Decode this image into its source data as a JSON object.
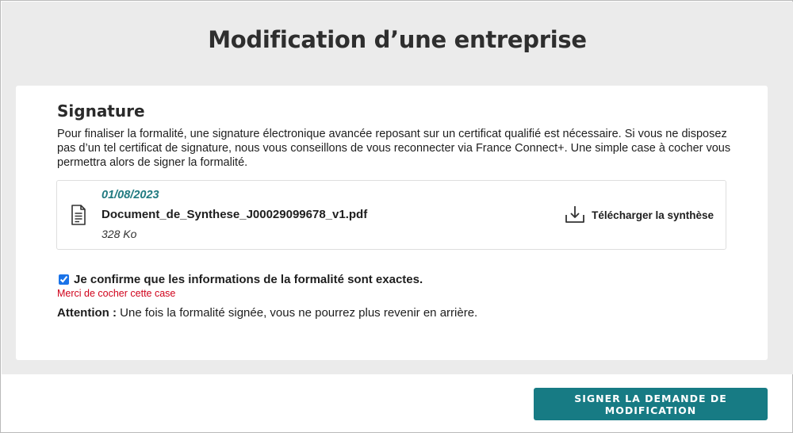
{
  "page": {
    "title": "Modification d’une entreprise"
  },
  "signature": {
    "title": "Signature",
    "intro": "Pour finaliser la formalité, une signature électronique avancée reposant sur un certificat qualifié est nécessaire. Si vous ne disposez pas d’un tel certificat de signature, nous vous conseillons de vous reconnecter via France Connect+. Une simple case à cocher vous permettra alors de signer la formalité."
  },
  "document": {
    "date": "01/08/2023",
    "filename": "Document_de_Synthese_J00029099678_v1.pdf",
    "size": "328 Ko",
    "download_label": "Télécharger la synthèse",
    "icon": "document-icon",
    "download_icon": "download-icon"
  },
  "confirmation": {
    "checked": true,
    "label": "Je confirme que les informations de la formalité sont exactes.",
    "error": "Merci de cocher cette case"
  },
  "warning": {
    "prefix": "Attention :",
    "text": " Une fois la formalité signée, vous ne pourrez plus revenir en arrière."
  },
  "actions": {
    "submit_label": "SIGNER LA DEMANDE DE MODIFICATION"
  },
  "colors": {
    "accent": "#177b84",
    "date": "#207a80",
    "error": "#d0021b",
    "background_band": "#ebebeb"
  }
}
